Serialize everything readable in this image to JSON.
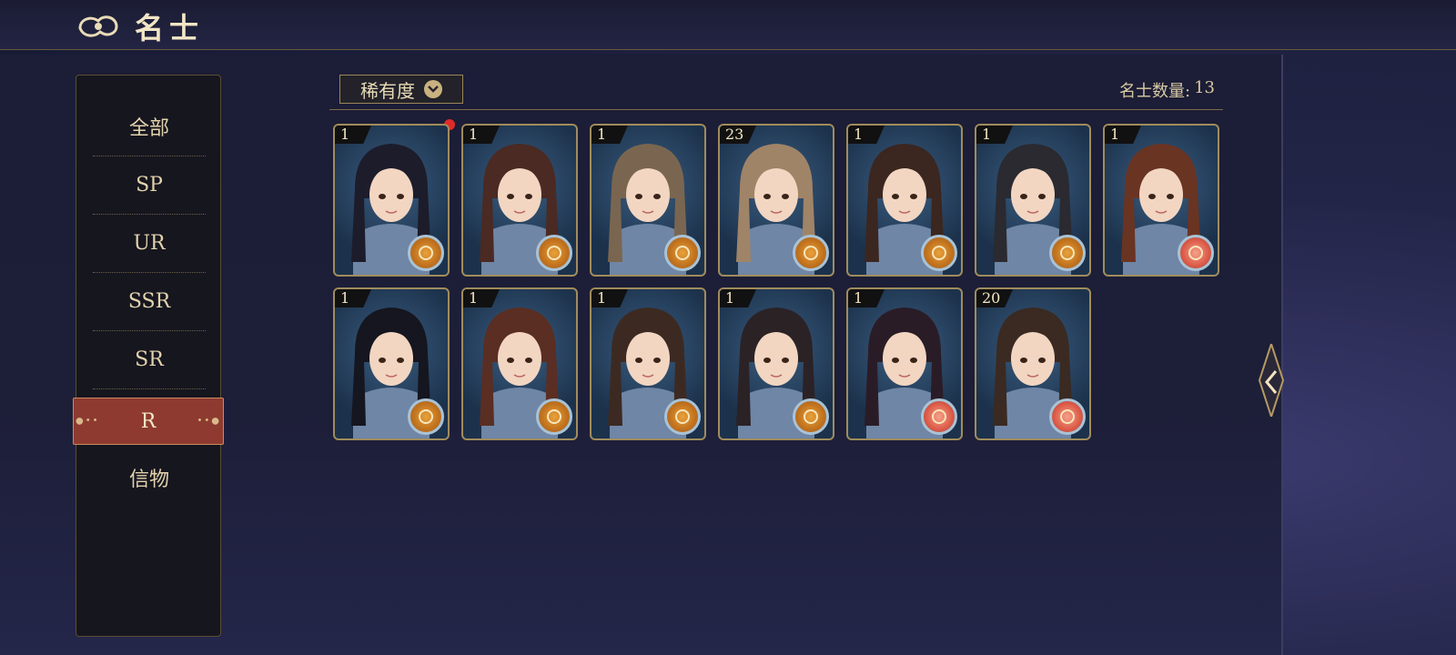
{
  "header": {
    "title": "名士"
  },
  "sidebar": {
    "items": [
      {
        "label": "全部"
      },
      {
        "label": "SP"
      },
      {
        "label": "UR"
      },
      {
        "label": "SSR"
      },
      {
        "label": "SR"
      },
      {
        "label": "R",
        "active": true
      },
      {
        "label": "信物"
      }
    ]
  },
  "filter": {
    "label": "稀有度"
  },
  "count": {
    "label": "名士数量:",
    "value": "13"
  },
  "cards": [
    {
      "level": "1",
      "badge": "gold",
      "new": true
    },
    {
      "level": "1",
      "badge": "gold"
    },
    {
      "level": "1",
      "badge": "gold"
    },
    {
      "level": "23",
      "badge": "gold"
    },
    {
      "level": "1",
      "badge": "gold"
    },
    {
      "level": "1",
      "badge": "gold"
    },
    {
      "level": "1",
      "badge": "pink"
    },
    {
      "level": "1",
      "badge": "gold"
    },
    {
      "level": "1",
      "badge": "gold"
    },
    {
      "level": "1",
      "badge": "gold"
    },
    {
      "level": "1",
      "badge": "gold"
    },
    {
      "level": "1",
      "badge": "pink"
    },
    {
      "level": "20",
      "badge": "pink"
    }
  ],
  "colors": {
    "accent": "#8e3a30",
    "gold": "#c9b27f",
    "panel": "#1c1d36"
  }
}
